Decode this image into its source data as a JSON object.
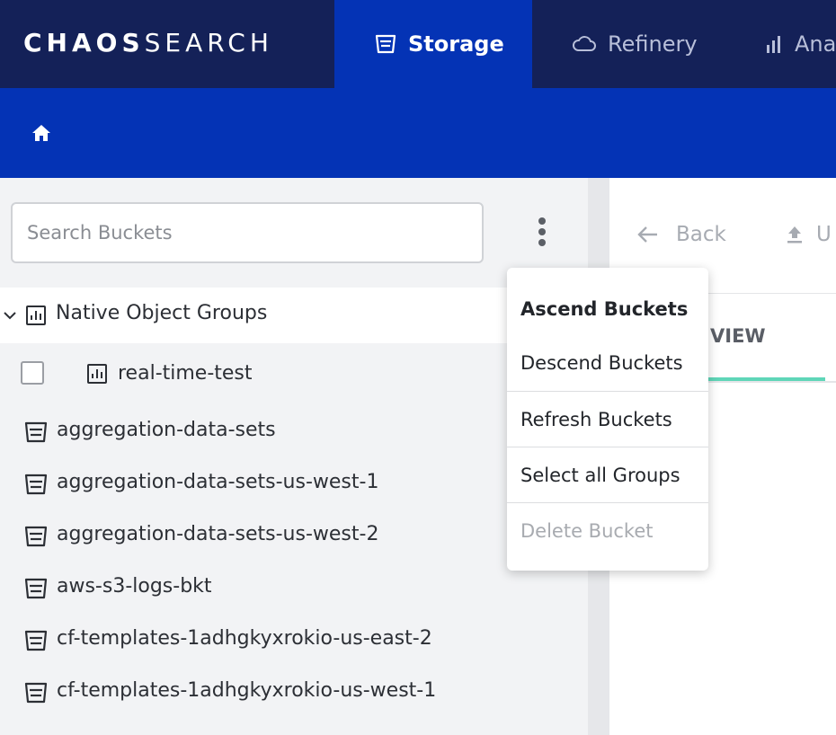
{
  "brand": {
    "part1": "CHAOS",
    "part2": "SEARCH"
  },
  "nav": {
    "tabs": [
      {
        "label": "Storage",
        "icon": "bucket-icon",
        "active": true
      },
      {
        "label": "Refinery",
        "icon": "cloud-icon",
        "active": false
      },
      {
        "label": "Ana",
        "icon": "bar-chart-icon",
        "active": false
      }
    ]
  },
  "subbar": {
    "icon": "home-icon"
  },
  "sidebar": {
    "search": {
      "placeholder": "Search Buckets",
      "value": ""
    },
    "group": {
      "label": "Native Object Groups",
      "expanded": true,
      "icon": "chart-icon"
    },
    "group_items": [
      {
        "label": "real-time-test",
        "checked": false,
        "icon": "chart-icon"
      }
    ],
    "buckets": [
      {
        "label": "aggregation-data-sets",
        "icon": "bucket-icon"
      },
      {
        "label": "aggregation-data-sets-us-west-1",
        "icon": "bucket-icon"
      },
      {
        "label": "aggregation-data-sets-us-west-2",
        "icon": "bucket-icon"
      },
      {
        "label": "aws-s3-logs-bkt",
        "icon": "bucket-icon"
      },
      {
        "label": "cf-templates-1adhgkyxrokio-us-east-2",
        "icon": "bucket-icon"
      },
      {
        "label": "cf-templates-1adhgkyxrokio-us-west-1",
        "icon": "bucket-icon"
      }
    ]
  },
  "content": {
    "back_label": "Back",
    "upload_label": "U",
    "view_tab_label": "VIEW"
  },
  "menu": {
    "items": [
      {
        "label": "Ascend Buckets",
        "state": "selected"
      },
      {
        "label": "Descend Buckets",
        "state": "normal"
      },
      {
        "label": "Refresh Buckets",
        "state": "normal"
      },
      {
        "label": "Select all Groups",
        "state": "normal"
      },
      {
        "label": "Delete Bucket",
        "state": "disabled"
      }
    ]
  },
  "colors": {
    "topbar": "#142158",
    "active_tab": "#0433b5",
    "accent_underline": "#5fd6b8",
    "sidebar_bg": "#f2f3f5"
  }
}
